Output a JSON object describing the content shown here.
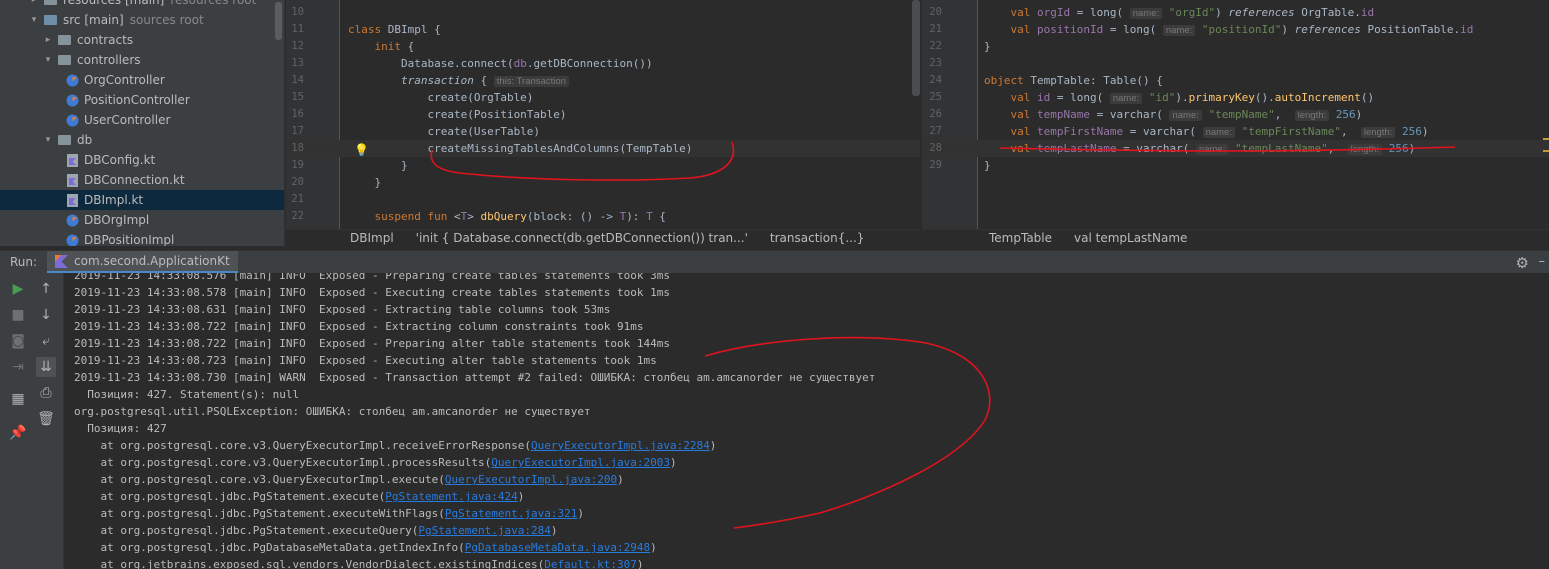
{
  "project_tree": {
    "items": [
      {
        "label": "resources [main]",
        "muted": "resources root",
        "type": "folder"
      },
      {
        "label": "src [main]",
        "muted": "sources root",
        "type": "src"
      },
      {
        "label": "contracts",
        "type": "folder"
      },
      {
        "label": "controllers",
        "type": "folder"
      },
      {
        "label": "OrgController",
        "type": "kotlin"
      },
      {
        "label": "PositionController",
        "type": "kotlin"
      },
      {
        "label": "UserController",
        "type": "kotlin"
      },
      {
        "label": "db",
        "type": "folder"
      },
      {
        "label": "DBConfig.kt",
        "type": "kotlinfile"
      },
      {
        "label": "DBConnection.kt",
        "type": "kotlinfile"
      },
      {
        "label": "DBImpl.kt",
        "type": "kotlinfile",
        "selected": true
      },
      {
        "label": "DBOrgImpl",
        "type": "kotlin"
      },
      {
        "label": "DBPositionImpl",
        "type": "kotlin"
      }
    ]
  },
  "editor_left": {
    "lines": [
      {
        "n": "10",
        "parts": []
      },
      {
        "n": "11",
        "parts": [
          [
            "kw",
            "class "
          ],
          [
            "pl",
            "DBImpl {"
          ]
        ]
      },
      {
        "n": "12",
        "parts": [
          [
            "pl",
            "    "
          ],
          [
            "kw",
            "init "
          ],
          [
            "pl",
            "{"
          ]
        ]
      },
      {
        "n": "13",
        "parts": [
          [
            "pl",
            "        Database.connect("
          ],
          [
            "purple",
            "db"
          ],
          [
            "pl",
            ".getDBConnection())"
          ]
        ]
      },
      {
        "n": "14",
        "parts": [
          [
            "pl",
            "        "
          ],
          [
            "it",
            "transaction "
          ],
          [
            "pl",
            "{ "
          ],
          [
            "hint",
            "this: Transaction"
          ]
        ]
      },
      {
        "n": "15",
        "parts": [
          [
            "pl",
            "            create(OrgTable)"
          ]
        ]
      },
      {
        "n": "16",
        "parts": [
          [
            "pl",
            "            create(PositionTable)"
          ]
        ]
      },
      {
        "n": "17",
        "parts": [
          [
            "pl",
            "            create(UserTable)"
          ]
        ]
      },
      {
        "n": "18",
        "parts": [
          [
            "pl",
            "            createMissingTablesAndColumns(TempTable)"
          ]
        ]
      },
      {
        "n": "19",
        "parts": [
          [
            "pl",
            "        }"
          ]
        ]
      },
      {
        "n": "20",
        "parts": [
          [
            "pl",
            "    }"
          ]
        ]
      },
      {
        "n": "21",
        "parts": []
      },
      {
        "n": "22",
        "parts": [
          [
            "pl",
            "    "
          ],
          [
            "kw",
            "suspend fun "
          ],
          [
            "pl",
            "<"
          ],
          [
            "purple",
            "T"
          ],
          [
            "pl",
            "> "
          ],
          [
            "fn",
            "dbQuery"
          ],
          [
            "pl",
            "(block: () -> "
          ],
          [
            "purple",
            "T"
          ],
          [
            "pl",
            "): "
          ],
          [
            "purple",
            "T"
          ],
          [
            "pl",
            " {"
          ]
        ]
      }
    ]
  },
  "editor_right": {
    "lines": [
      {
        "n": "20",
        "parts": [
          [
            "pl",
            "    "
          ],
          [
            "kw",
            "val "
          ],
          [
            "purple",
            "orgId "
          ],
          [
            "pl",
            "= long( "
          ],
          [
            "hint",
            "name:"
          ],
          [
            "str",
            " \"orgId\""
          ],
          [
            "pl",
            ") "
          ],
          [
            "it",
            "references "
          ],
          [
            "pl",
            "OrgTable."
          ],
          [
            "purple",
            "id"
          ]
        ]
      },
      {
        "n": "21",
        "parts": [
          [
            "pl",
            "    "
          ],
          [
            "kw",
            "val "
          ],
          [
            "purple",
            "positionId "
          ],
          [
            "pl",
            "= long( "
          ],
          [
            "hint",
            "name:"
          ],
          [
            "str",
            " \"positionId\""
          ],
          [
            "pl",
            ") "
          ],
          [
            "it",
            "references "
          ],
          [
            "pl",
            "PositionTable."
          ],
          [
            "purple",
            "id"
          ]
        ]
      },
      {
        "n": "22",
        "parts": [
          [
            "pl",
            "}"
          ]
        ]
      },
      {
        "n": "23",
        "parts": []
      },
      {
        "n": "24",
        "parts": [
          [
            "kw",
            "object "
          ],
          [
            "pl",
            "TempTable: Table() {"
          ]
        ]
      },
      {
        "n": "25",
        "parts": [
          [
            "pl",
            "    "
          ],
          [
            "kw",
            "val "
          ],
          [
            "purple",
            "id "
          ],
          [
            "pl",
            "= long( "
          ],
          [
            "hint",
            "name:"
          ],
          [
            "str",
            " \"id\""
          ],
          [
            "pl",
            ")."
          ],
          [
            "fn",
            "primaryKey"
          ],
          [
            "pl",
            "()."
          ],
          [
            "fn",
            "autoIncrement"
          ],
          [
            "pl",
            "()"
          ]
        ]
      },
      {
        "n": "26",
        "parts": [
          [
            "pl",
            "    "
          ],
          [
            "kw",
            "val "
          ],
          [
            "purple",
            "tempName "
          ],
          [
            "pl",
            "= varchar( "
          ],
          [
            "hint",
            "name:"
          ],
          [
            "str",
            " \"tempName\""
          ],
          [
            "pl",
            ",  "
          ],
          [
            "hint",
            "length:"
          ],
          [
            "num",
            " 256"
          ],
          [
            "pl",
            ")"
          ]
        ]
      },
      {
        "n": "27",
        "parts": [
          [
            "pl",
            "    "
          ],
          [
            "kw",
            "val "
          ],
          [
            "purple",
            "tempFirstName "
          ],
          [
            "pl",
            "= varchar( "
          ],
          [
            "hint",
            "name:"
          ],
          [
            "str",
            " \"tempFirstName\""
          ],
          [
            "pl",
            ",  "
          ],
          [
            "hint",
            "length:"
          ],
          [
            "num",
            " 256"
          ],
          [
            "pl",
            ")"
          ]
        ]
      },
      {
        "n": "28",
        "parts": [
          [
            "pl",
            "    "
          ],
          [
            "kw",
            "val "
          ],
          [
            "purple",
            "tempLastName "
          ],
          [
            "pl",
            "= varchar( "
          ],
          [
            "hint",
            "name:"
          ],
          [
            "str",
            " \"tempLastName\""
          ],
          [
            "pl",
            ",  "
          ],
          [
            "hint",
            "length:"
          ],
          [
            "num",
            " 256"
          ],
          [
            "pl",
            ")"
          ]
        ]
      },
      {
        "n": "29",
        "parts": [
          [
            "pl",
            "}"
          ]
        ]
      }
    ]
  },
  "breadcrumbs_left": [
    "DBImpl",
    "'init { Database.connect(db.getDBConnection()) tran...'",
    "transaction{...}"
  ],
  "breadcrumbs_right": [
    "TempTable",
    "val tempLastName"
  ],
  "run": {
    "label": "Run:",
    "tab": "com.second.ApplicationKt"
  },
  "console": {
    "lines": [
      {
        "text": "2019-11-23 14:33:08.576 [main] INFO  Exposed - Preparing create tables statements took 3ms"
      },
      {
        "text": "2019-11-23 14:33:08.578 [main] INFO  Exposed - Executing create tables statements took 1ms"
      },
      {
        "text": "2019-11-23 14:33:08.631 [main] INFO  Exposed - Extracting table columns took 53ms"
      },
      {
        "text": "2019-11-23 14:33:08.722 [main] INFO  Exposed - Extracting column constraints took 91ms"
      },
      {
        "text": "2019-11-23 14:33:08.722 [main] INFO  Exposed - Preparing alter table statements took 144ms"
      },
      {
        "text": "2019-11-23 14:33:08.723 [main] INFO  Exposed - Executing alter table statements took 1ms"
      },
      {
        "text": "2019-11-23 14:33:08.730 [main] WARN  Exposed - Transaction attempt #2 failed: ОШИБКА: столбец am.amcanorder не существует"
      },
      {
        "text": "  Позиция: 427. Statement(s): null"
      },
      {
        "text": "org.postgresql.util.PSQLException: ОШИБКА: столбец am.amcanorder не существует"
      },
      {
        "text": "  Позиция: 427"
      },
      {
        "text": "    at org.postgresql.core.v3.QueryExecutorImpl.receiveErrorResponse(",
        "link": "QueryExecutorImpl.java:2284",
        "tail": ")"
      },
      {
        "text": "    at org.postgresql.core.v3.QueryExecutorImpl.processResults(",
        "link": "QueryExecutorImpl.java:2003",
        "tail": ")"
      },
      {
        "text": "    at org.postgresql.core.v3.QueryExecutorImpl.execute(",
        "link": "QueryExecutorImpl.java:200",
        "tail": ")"
      },
      {
        "text": "    at org.postgresql.jdbc.PgStatement.execute(",
        "link": "PgStatement.java:424",
        "tail": ")"
      },
      {
        "text": "    at org.postgresql.jdbc.PgStatement.executeWithFlags(",
        "link": "PgStatement.java:321",
        "tail": ")"
      },
      {
        "text": "    at org.postgresql.jdbc.PgStatement.executeQuery(",
        "link": "PgStatement.java:284",
        "tail": ")"
      },
      {
        "text": "    at org.postgresql.jdbc.PgDatabaseMetaData.getIndexInfo(",
        "link": "PgDatabaseMetaData.java:2948",
        "tail": ")"
      },
      {
        "text": "    at org.jetbrains.exposed.sql.vendors.VendorDialect.existingIndices(",
        "link": "Default.kt:307",
        "tail": ")"
      }
    ]
  },
  "colors": {
    "background": "#2b2b2b",
    "panel": "#3c3f41",
    "keyword": "#cc7832",
    "string": "#6a8759",
    "number": "#6897bb",
    "link": "#287bde",
    "annotation_red": "#e0141e"
  }
}
